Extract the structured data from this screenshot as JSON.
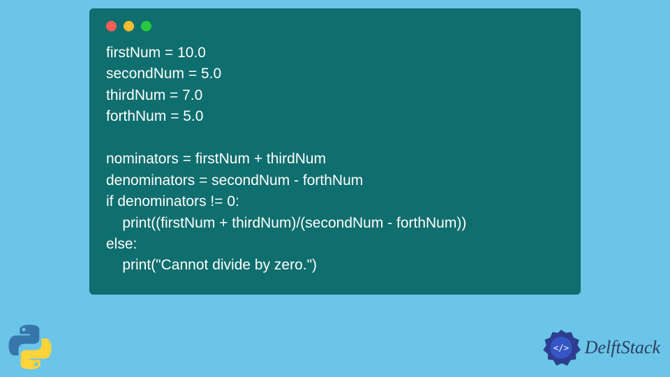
{
  "window": {
    "traffic_colors": {
      "red": "#ff5f56",
      "yellow": "#ffbd2e",
      "green": "#27c93f"
    },
    "background": "#0f6e6e"
  },
  "code": {
    "lines": [
      "firstNum = 10.0",
      "secondNum = 5.0",
      "thirdNum = 7.0",
      "forthNum = 5.0",
      "",
      "nominators = firstNum + thirdNum",
      "denominators = secondNum - forthNum",
      "if denominators != 0:",
      "    print((firstNum + thirdNum)/(secondNum - forthNum))",
      "else:",
      "    print(\"Cannot divide by zero.\")"
    ]
  },
  "brand": {
    "name": "DelftStack"
  },
  "icons": {
    "python": "python-logo-icon",
    "delft": "delft-gear-icon"
  }
}
